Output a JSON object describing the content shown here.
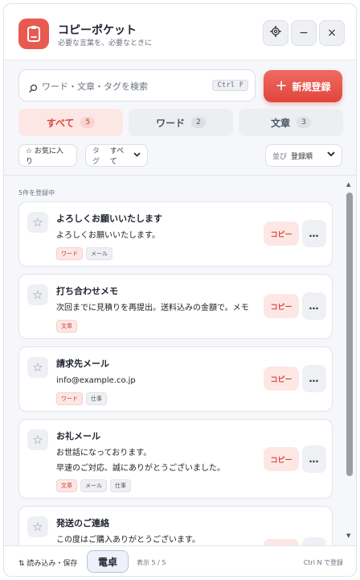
{
  "header": {
    "title": "コピーポケット",
    "subtitle": "必要な言葉を、必要なときに",
    "icons": {
      "app": "clipboard-icon",
      "settings": "gear-icon",
      "minimize": "minimize-icon",
      "close": "close-icon"
    },
    "minimize_glyph": "−",
    "close_glyph": "×"
  },
  "search": {
    "placeholder": "ワード・文章・タグを検索",
    "shortcut": "Ctrl F"
  },
  "new_button": {
    "plus": "+",
    "label": "新規登録"
  },
  "tabs": [
    {
      "label": "すべて",
      "count": "5"
    },
    {
      "label": "ワード",
      "count": "2"
    },
    {
      "label": "文章",
      "count": "3"
    }
  ],
  "filters": {
    "favorites": "☆ お気に入り",
    "tag_prefix": "タグ",
    "tag_value": "すべて",
    "sort_prefix": "並び",
    "sort_value": "登録順"
  },
  "list": {
    "status": "5件を登録中",
    "copy_label": "コピー",
    "more_label": "…",
    "items": [
      {
        "title": "よろしくお願いいたします",
        "lines": [
          "よろしくお願いいたします。"
        ],
        "tags": [
          "ワード",
          "メール"
        ]
      },
      {
        "title": "打ち合わせメモ",
        "lines": [
          "次回までに見積りを再提出。送料込みの金額で。メモ"
        ],
        "tags": [
          "文章"
        ]
      },
      {
        "title": "請求先メール",
        "lines": [
          "info@example.co.jp"
        ],
        "tags": [
          "ワード",
          "仕事"
        ]
      },
      {
        "title": "お礼メール",
        "lines": [
          "お世話になっております。",
          "早速のご対応、誠にありがとうございました。"
        ],
        "tags": [
          "文章",
          "メール",
          "仕事"
        ]
      },
      {
        "title": "発送のご連絡",
        "lines": [
          "この度はご購入ありがとうございます。"
        ],
        "tags": []
      }
    ]
  },
  "footer": {
    "import_export": "⇅ 読み込み・保存",
    "calculator": "電卓",
    "count": "表示 5 / 5",
    "hint": "Ctrl N で登録"
  },
  "colors": {
    "accent": "#e0463d",
    "accent_light": "#fde7e5",
    "background": "#f6f7fa"
  }
}
